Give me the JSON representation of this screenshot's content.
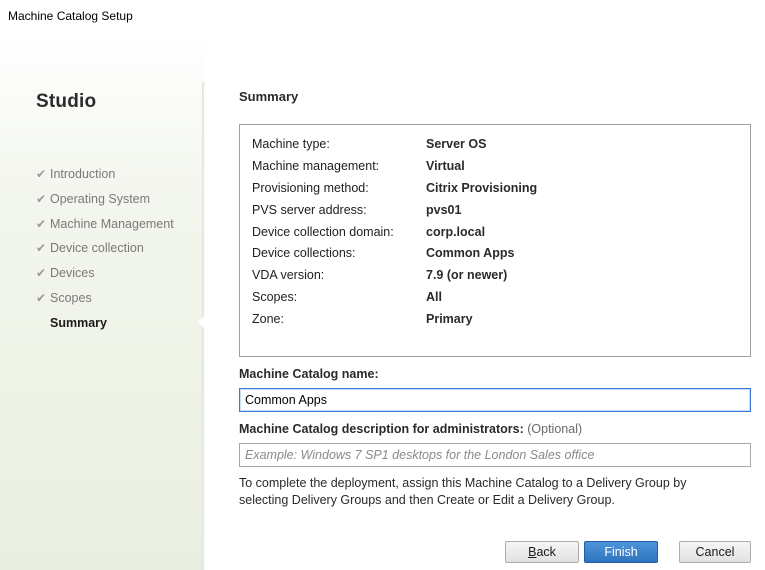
{
  "window": {
    "title": "Machine Catalog Setup"
  },
  "sidebar": {
    "app_name": "Studio",
    "steps": [
      {
        "label": "Introduction",
        "done": true
      },
      {
        "label": "Operating System",
        "done": true
      },
      {
        "label": "Machine Management",
        "done": true
      },
      {
        "label": "Device collection",
        "done": true
      },
      {
        "label": "Devices",
        "done": true
      },
      {
        "label": "Scopes",
        "done": true
      },
      {
        "label": "Summary",
        "done": false,
        "current": true
      }
    ],
    "check_glyph": "✔"
  },
  "main": {
    "section_title": "Summary",
    "summary": [
      {
        "key": "Machine type:",
        "value": "Server OS"
      },
      {
        "key": "Machine management:",
        "value": "Virtual"
      },
      {
        "key": "Provisioning method:",
        "value": "Citrix Provisioning"
      },
      {
        "key": "PVS server address:",
        "value": "pvs01"
      },
      {
        "key": "Device collection domain:",
        "value": "corp.local"
      },
      {
        "key": "Device collections:",
        "value": "Common Apps"
      },
      {
        "key": "VDA version:",
        "value": "7.9 (or newer)"
      },
      {
        "key": "Scopes:",
        "value": "All"
      },
      {
        "key": "Zone:",
        "value": "Primary"
      }
    ],
    "catalog_name": {
      "label": "Machine Catalog name:",
      "value": "Common Apps"
    },
    "catalog_description": {
      "label": "Machine Catalog description for administrators:",
      "optional": "(Optional)",
      "value": "",
      "placeholder": "Example: Windows 7 SP1 desktops for the London Sales office"
    },
    "note": "To complete the deployment, assign this Machine Catalog to a Delivery Group by selecting Delivery Groups and then Create or Edit a Delivery Group."
  },
  "buttons": {
    "back_accel": "B",
    "back_rest": "ack",
    "finish": "Finish",
    "cancel": "Cancel"
  }
}
